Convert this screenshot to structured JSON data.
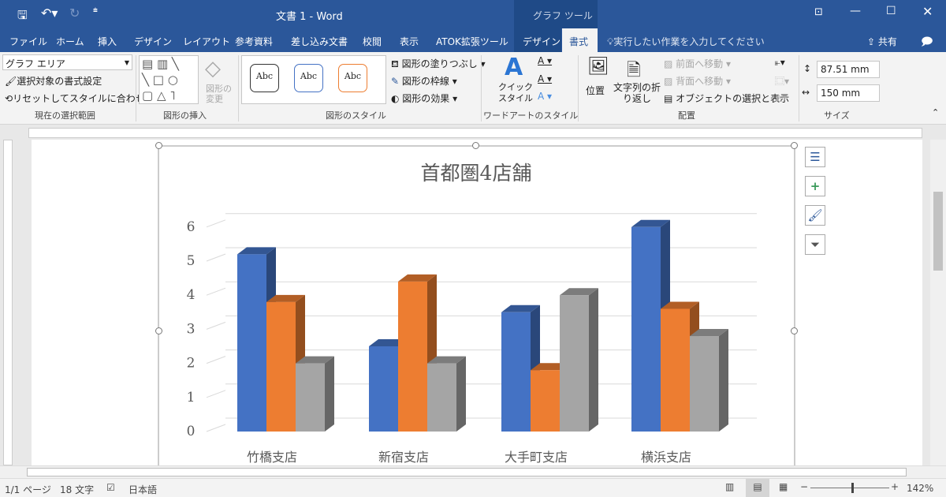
{
  "title_bar": {
    "title": "文書 1  -  Word",
    "context_tab_group": "グラフ ツール",
    "icons": [
      "save-icon",
      "undo-icon",
      "redo-icon",
      "customize-qat-icon",
      "ribbon-display-icon",
      "minimize-icon",
      "maximize-icon",
      "close-icon"
    ]
  },
  "tabs": [
    "ファイル",
    "ホーム",
    "挿入",
    "デザイン",
    "レイアウト",
    "参考資料",
    "差し込み文書",
    "校閲",
    "表示",
    "ATOK拡張ツール",
    "デザイン",
    "書式"
  ],
  "active_tab": "書式",
  "tell_me": "実行したい作業を入力してください",
  "share": "共有",
  "ribbon": {
    "selection": {
      "dropdown": "グラフ エリア",
      "format_selection": "選択対象の書式設定",
      "reset_style": "リセットしてスタイルに合わせる",
      "group": "現在の選択範囲"
    },
    "insert_shapes": {
      "change_shape": "図形の\n変更",
      "group": "図形の挿入"
    },
    "shape_styles": {
      "samples": [
        "Abc",
        "Abc",
        "Abc"
      ],
      "fill": "図形の塗りつぶし",
      "outline": "図形の枠線",
      "effects": "図形の効果",
      "group": "図形のスタイル"
    },
    "wordart": {
      "quick_style": "クイック\nスタイル",
      "group": "ワードアートのスタイル"
    },
    "arrange": {
      "position": "位置",
      "wrap": "文字列の折\nり返し",
      "bring_forward": "前面へ移動",
      "send_backward": "背面へ移動",
      "selection_pane": "オブジェクトの選択と表示",
      "group": "配置"
    },
    "size": {
      "height": "87.51 mm",
      "width": "150 mm",
      "group": "サイズ"
    }
  },
  "status": {
    "page": "1/1 ページ",
    "words": "18 文字",
    "language": "日本語",
    "zoom": "142%",
    "zoom_level": 142
  },
  "chart_data": {
    "type": "bar",
    "style": "3d-clustered-column",
    "title": "首都圏4店舗",
    "categories": [
      "竹橋支店",
      "新宿支店",
      "大手町支店",
      "横浜支店"
    ],
    "series": [
      {
        "color": "#4472c4",
        "values": [
          5.2,
          2.5,
          3.5,
          6.0
        ]
      },
      {
        "color": "#ed7d31",
        "values": [
          3.8,
          4.4,
          1.8,
          3.6
        ]
      },
      {
        "color": "#a5a5a5",
        "values": [
          2.0,
          2.0,
          4.0,
          2.8
        ]
      }
    ],
    "yticks": [
      0,
      1,
      2,
      3,
      4,
      5,
      6
    ],
    "ylim": [
      0,
      6
    ],
    "grid": true
  }
}
